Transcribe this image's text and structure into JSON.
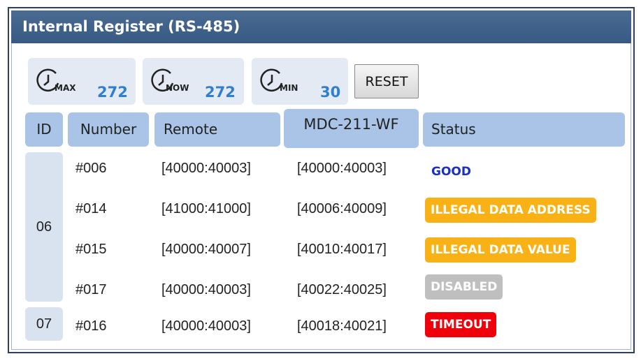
{
  "panel": {
    "title": "Internal Register (RS-485)"
  },
  "counters": [
    {
      "label": "MAX",
      "value": "272",
      "icon": "clock-icon"
    },
    {
      "label": "NOW",
      "value": "272",
      "icon": "clock-icon"
    },
    {
      "label": "MIN",
      "value": "30",
      "icon": "clock-icon"
    }
  ],
  "reset_label": "RESET",
  "columns": {
    "id": "ID",
    "number": "Number",
    "remote": "Remote",
    "device": "MDC-211-WF",
    "status": "Status"
  },
  "groups": [
    {
      "id": "06"
    },
    {
      "id": "07"
    }
  ],
  "rows": [
    {
      "number": "#006",
      "remote": "[40000:40003]",
      "device": "[40000:40003]",
      "status": "GOOD"
    },
    {
      "number": "#014",
      "remote": "[41000:41000]",
      "device": "[40006:40009]",
      "status": "ILLEGAL DATA ADDRESS"
    },
    {
      "number": "#015",
      "remote": "[40000:40007]",
      "device": "[40010:40017]",
      "status": "ILLEGAL DATA VALUE"
    },
    {
      "number": "#017",
      "remote": "[40000:40003]",
      "device": "[40022:40025]",
      "status": "DISABLED"
    },
    {
      "number": "#016",
      "remote": "[40000:40003]",
      "device": "[40018:40021]",
      "status": "TIMEOUT"
    }
  ],
  "status_colors": {
    "good": "#1a2fc4",
    "illegal": "#f9b215",
    "disabled": "#bfbfbf",
    "timeout": "#f0000a"
  }
}
